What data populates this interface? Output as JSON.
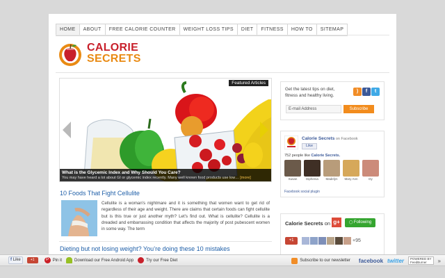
{
  "nav": [
    "HOME",
    "ABOUT",
    "FREE CALORIE COUNTER",
    "WEIGHT LOSS TIPS",
    "DIET",
    "FITNESS",
    "HOW TO",
    "SITEMAP"
  ],
  "logo": {
    "line1": "CALORIE",
    "line2": "SECRETS"
  },
  "slider": {
    "tag": "Featured Articles",
    "caption_title": "What is the Glycemic Index and Why Should You Care?",
    "caption_text": "You may have heard a lot about GI or glycemic index recently.  Many well known food products use low…",
    "more": "[more]"
  },
  "article": {
    "title": "10 Foods That Fight Cellulite",
    "body": "Cellulite is a woman's nightmare and it is something that women want to get rid of regardless of their age and weight. There are claims that certain foods can fight cellulite but is this true or just another myth? Let's find out.  What is cellulite? Cellulite is a dreaded and embarrassing condition that affects the majority of post pubescent women in some way.  The term"
  },
  "article2": {
    "title": "Dieting but not losing weight? You’re doing these 10 mistakes"
  },
  "newsletter": {
    "text": "Get the latest tips on diet, fitness and healthy living.",
    "email_placeholder": "E-mail Address",
    "subscribe_label": "Subscribe",
    "icons": [
      {
        "name": "rss-icon",
        "glyph": ")",
        "color": "#f18d27"
      },
      {
        "name": "facebook-icon",
        "glyph": "f",
        "color": "#3b5998"
      },
      {
        "name": "twitter-icon",
        "glyph": "t",
        "color": "#3fa9e6"
      }
    ]
  },
  "facebook": {
    "name": "Calorie Secrets",
    "on": " on Facebook",
    "like": "Like",
    "count_prefix": "752 people like ",
    "count_name": "Calorie Secrets.",
    "fans": [
      {
        "name": "Susan",
        "color": "#6b5a4a"
      },
      {
        "name": "Diphenia",
        "color": "#3f2f25"
      },
      {
        "name": "Madelyn",
        "color": "#b89c7a"
      },
      {
        "name": "Mary Ann",
        "color": "#d6a85a"
      },
      {
        "name": "Dy",
        "color": "#cc8b7a"
      }
    ],
    "plugin": "Facebook social plugin"
  },
  "googleplus": {
    "name": "Calorie Secrets",
    "on": " on",
    "following": "Following",
    "plus1": "+1",
    "more": "+95",
    "face_colors": [
      "#a9b7d8",
      "#8ea3c9",
      "#7e8fb8",
      "#b8a48a",
      "#5a4b3b",
      "#c7a08a"
    ]
  },
  "bottom_bar": {
    "like": "Like",
    "plus": "+1",
    "pin": "Pin it",
    "android": "Download our Free Android App",
    "diet": "Try our Free Diet",
    "newsletter": "Subscribe to our newsletter",
    "facebook": "facebook",
    "twitter": "twitter",
    "powered": "POWERED BY\nFeedBurner",
    "collapse": "»"
  }
}
